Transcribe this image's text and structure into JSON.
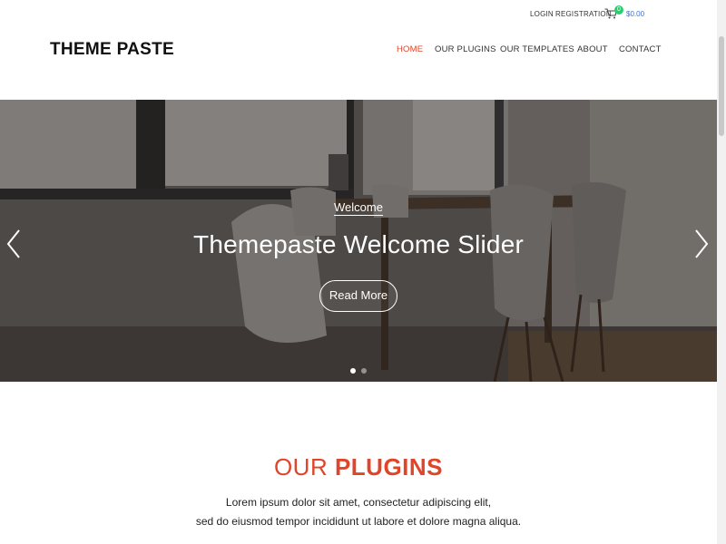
{
  "topbar": {
    "login": "LOGIN",
    "registration": "REGISTRATION",
    "cart_count": "0",
    "cart_total": "$0.00",
    "cart_icon": "shopping-cart-icon"
  },
  "header": {
    "logo": "THEME PASTE",
    "nav": [
      "HOME",
      "OUR PLUGINS",
      "OUR TEMPLATES",
      "ABOUT",
      "CONTACT"
    ],
    "active_nav": "HOME"
  },
  "slider": {
    "kicker": "Welcome",
    "title": "Themepaste Welcome Slider",
    "button": "Read More",
    "prev_icon": "chevron-left-icon",
    "next_icon": "chevron-right-icon",
    "slides": 2,
    "active_slide": 1
  },
  "plugins_section": {
    "title_light": "OUR ",
    "title_bold": "PLUGINS",
    "line1": "Lorem ipsum dolor sit amet, consectetur adipiscing elit,",
    "line2": "sed do eiusmod tempor incididunt ut labore et dolore magna aliqua."
  },
  "colors": {
    "accent": "#e0452a",
    "cart_badge": "#2ecc71",
    "cart_total": "#3a6fd8"
  }
}
